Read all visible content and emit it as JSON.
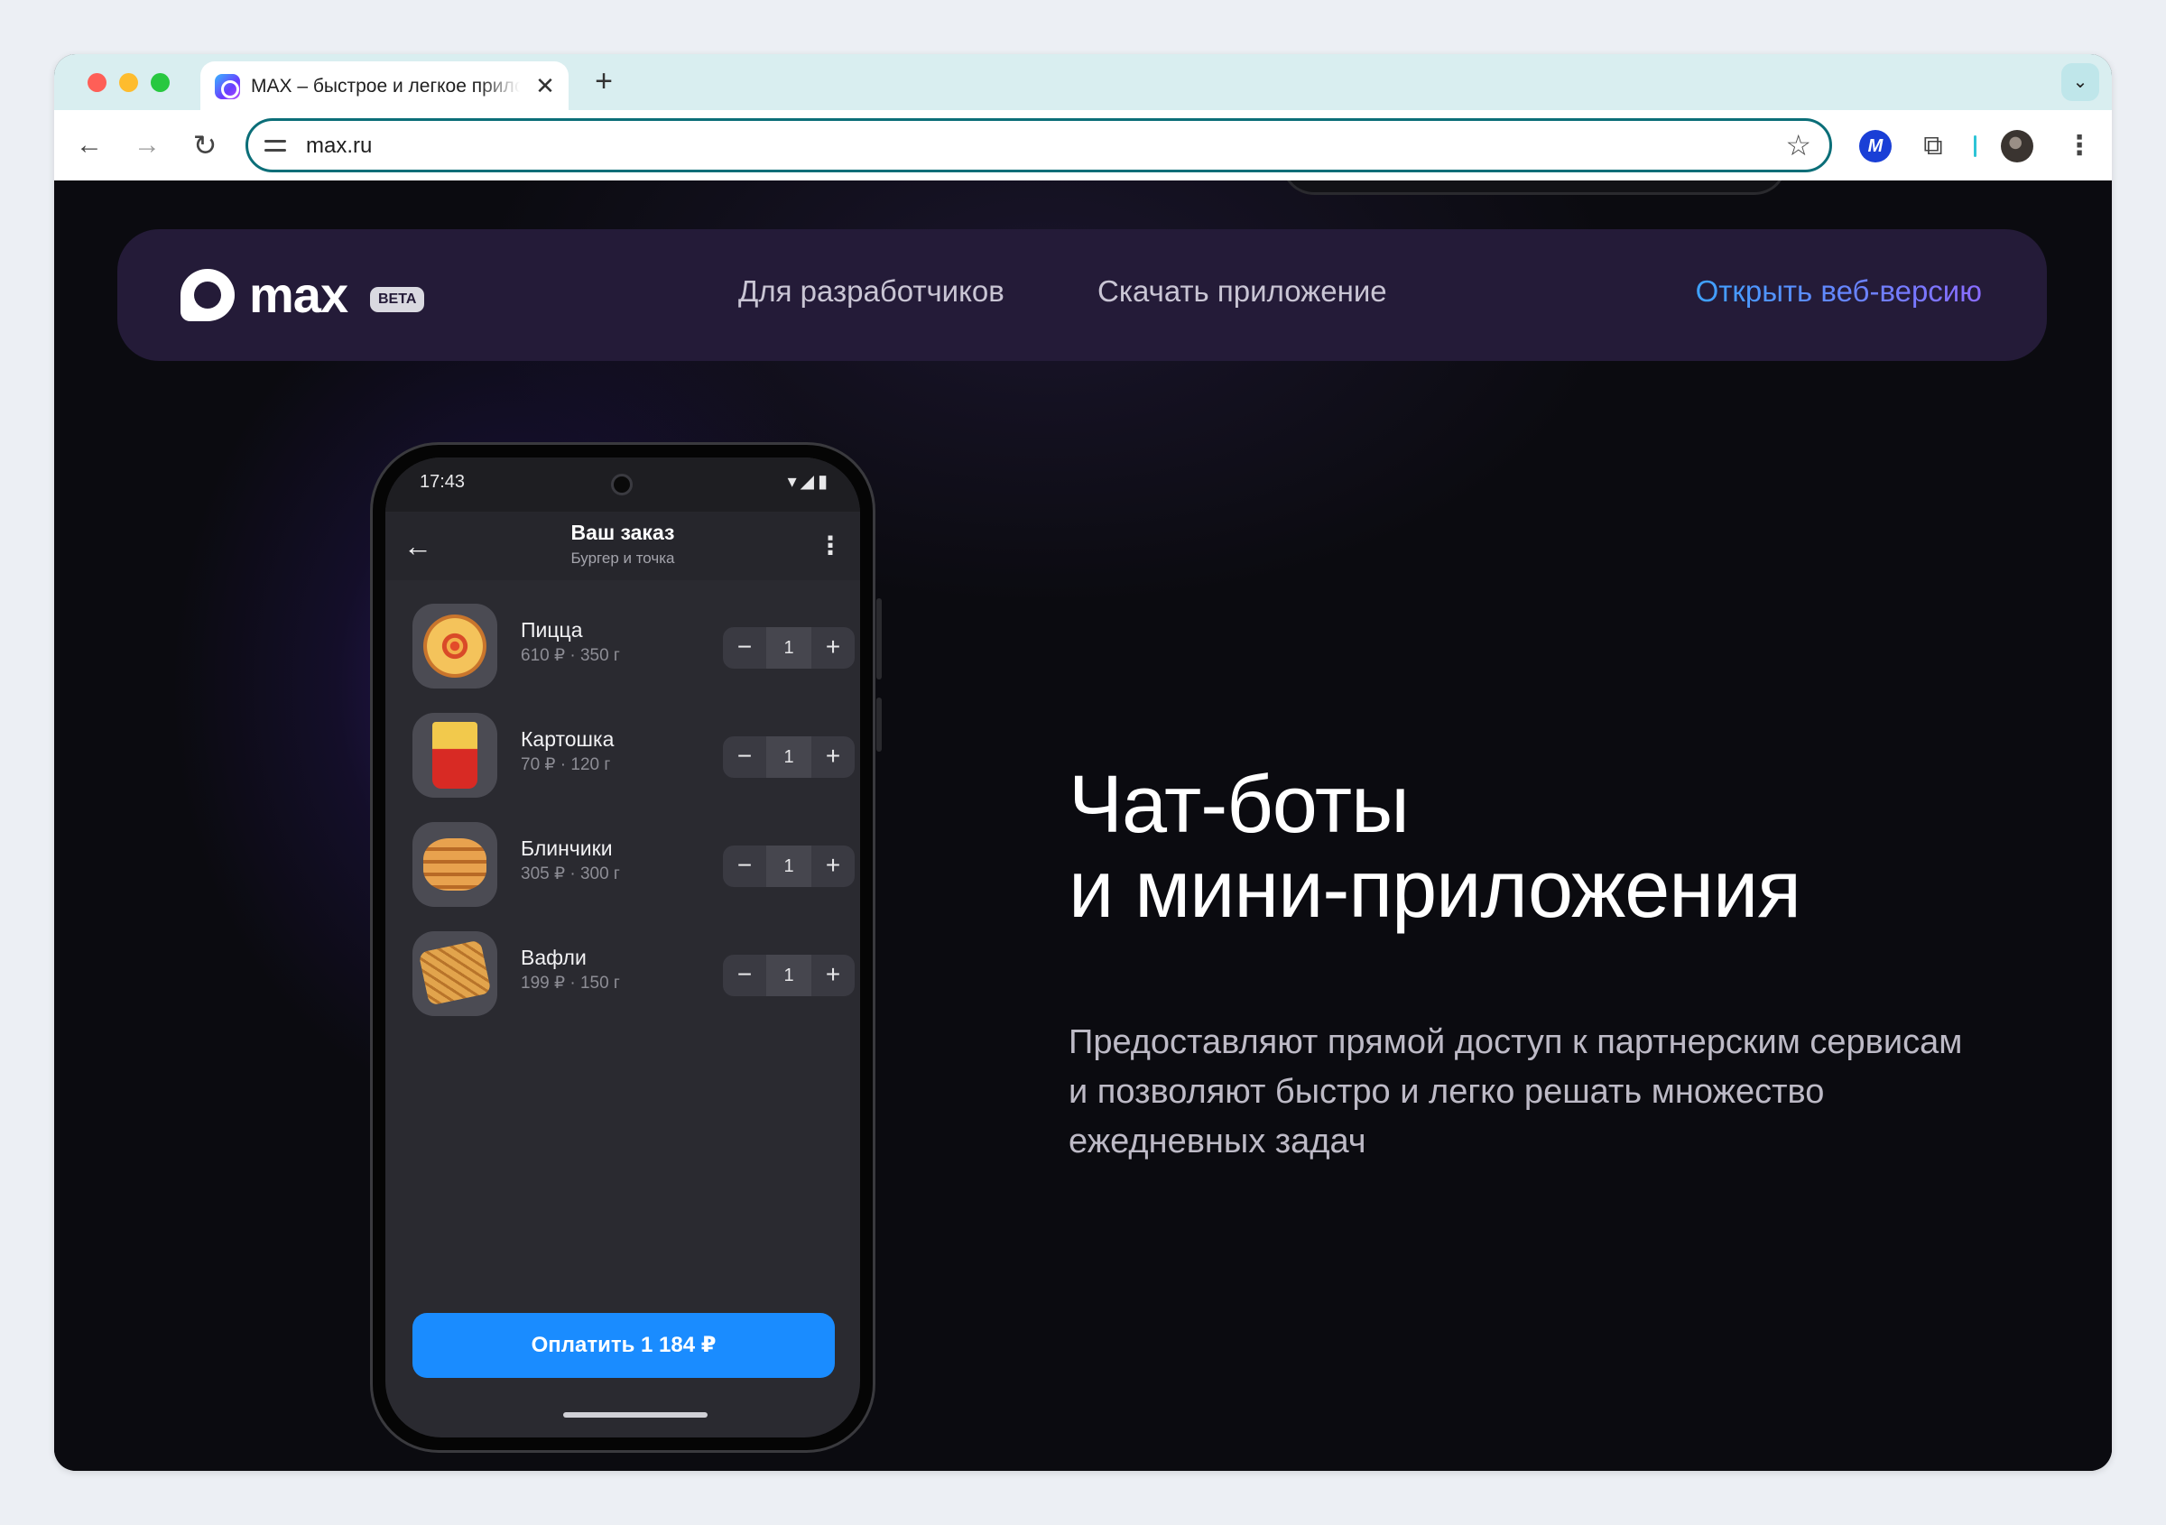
{
  "browser": {
    "tab_title": "MAX – быстрое и легкое приложение для общения",
    "tab_close": "✕",
    "new_tab": "+",
    "tab_search": "⌄",
    "back": "←",
    "forward": "→",
    "reload": "↻",
    "url": "max.ru",
    "bookmark_star": "☆",
    "extension_brand": "M",
    "extension_puzzle": "⧉",
    "menu_kebab": "⋮"
  },
  "header": {
    "logo_text": "max",
    "badge": "BETA",
    "nav": [
      "Для разработчиков",
      "Скачать приложение"
    ],
    "cta": "Открыть веб-версию"
  },
  "phone": {
    "time": "17:43",
    "status_icons": "▾◢▮",
    "back": "←",
    "title": "Ваш заказ",
    "subtitle": "Бургер и точка",
    "more": "⋮",
    "items": [
      {
        "name": "Пицца",
        "meta": "610 ₽ · 350 г",
        "qty": "1",
        "icon": "pizza-icon"
      },
      {
        "name": "Картошка",
        "meta": "70 ₽ · 120 г",
        "qty": "1",
        "icon": "fries-icon"
      },
      {
        "name": "Блинчики",
        "meta": "305 ₽ · 300 г",
        "qty": "1",
        "icon": "pancakes-icon"
      },
      {
        "name": "Вафли",
        "meta": "199 ₽ · 150 г",
        "qty": "1",
        "icon": "waffle-icon"
      }
    ],
    "minus": "−",
    "plus": "+",
    "pay_button": "Оплатить 1 184 ₽"
  },
  "hero": {
    "title_line1": "Чат-боты",
    "title_line2": "и мини-приложения",
    "description": "Предоставляют прямой доступ к партнерским сервисам и позволяют быстро и легко решать множество ежедневных задач"
  },
  "colors": {
    "accent_blue": "#1a8cff",
    "header_bg": "#241b38",
    "omnibox_border": "#0b6e78"
  }
}
